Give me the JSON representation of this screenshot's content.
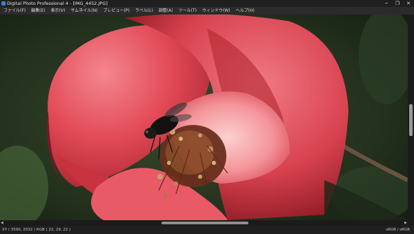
{
  "window": {
    "title": "Digital Photo Professional 4 - [IMG_4452.JPG]",
    "controls": {
      "minimize": "─",
      "restore": "❐",
      "close": "✕"
    }
  },
  "menu": {
    "items": [
      "ファイル(F)",
      "編集(E)",
      "表示(V)",
      "サムネイル(N)",
      "プレビュー(P)",
      "ラベル(L)",
      "調整(A)",
      "ツール(T)",
      "ウィンドウ(W)",
      "ヘルプ(H)"
    ]
  },
  "image": {
    "subject": "red camellia flower with a fly on its stamens",
    "colors": {
      "petal": "#e04a55",
      "petal_highlight": "#f27b86",
      "shadow": "#6d1a1f",
      "background": "#243320"
    }
  },
  "scroll": {
    "left_arrow": "◀",
    "right_arrow": "▶"
  },
  "status": {
    "left": "XY  ( 3590, 2032 ) RGB (  22,  29,  22 )",
    "right": "sRGB / sRGB"
  }
}
